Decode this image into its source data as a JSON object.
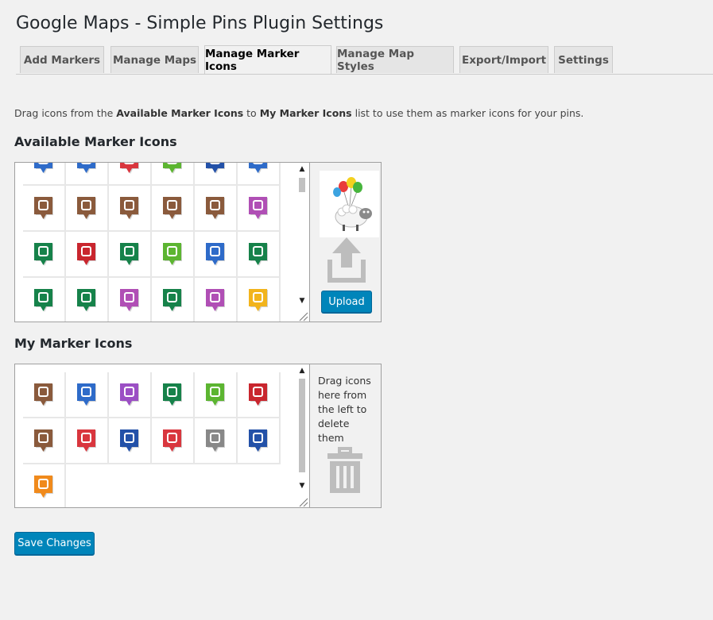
{
  "page": {
    "title": "Google Maps - Simple Pins Plugin Settings"
  },
  "tabs": [
    {
      "label": "Add Markers",
      "active": false
    },
    {
      "label": "Manage Maps",
      "active": false
    },
    {
      "label": "Manage Marker Icons",
      "active": true
    },
    {
      "label": "Manage Map Styles",
      "active": false
    },
    {
      "label": "Export/Import",
      "active": false
    },
    {
      "label": "Settings",
      "active": false
    }
  ],
  "description": {
    "prefix": "Drag icons from the ",
    "source_name": "Available Marker Icons",
    "middle": " to ",
    "target_name": "My Marker Icons",
    "suffix": " list to use them as marker icons for your pins."
  },
  "available": {
    "title": "Available Marker Icons",
    "upload_label": "Upload",
    "upload_preview_icon": "flying-sheep-with-balloons-image",
    "upload_arrow_icon": "upload-arrow-icon",
    "rows": [
      [
        {
          "icon": "marker-partial-icon",
          "color": "#2e6bc9"
        },
        {
          "icon": "marker-partial-icon",
          "color": "#2e6bc9"
        },
        {
          "icon": "marker-partial-icon",
          "color": "#d9363e"
        },
        {
          "icon": "marker-partial-icon",
          "color": "#5cb531"
        },
        {
          "icon": "marker-partial-icon",
          "color": "#2351a8"
        },
        {
          "icon": "marker-partial-icon",
          "color": "#2e6bc9"
        }
      ],
      [
        {
          "icon": "crossed-tools-icon",
          "color": "#8a5a3c"
        },
        {
          "icon": "airplane-icon",
          "color": "#8a5a3c"
        },
        {
          "icon": "aircraft-hangar-icon",
          "color": "#8a5a3c"
        },
        {
          "icon": "runway-plane-icon",
          "color": "#8a5a3c"
        },
        {
          "icon": "factory-icon",
          "color": "#8a5a3c"
        },
        {
          "icon": "waterslide-icon",
          "color": "#b04fb5"
        }
      ],
      [
        {
          "icon": "tree-icon",
          "color": "#16824a"
        },
        {
          "icon": "alien-icon",
          "color": "#c9262e"
        },
        {
          "icon": "crocodile-icon",
          "color": "#16824a"
        },
        {
          "icon": "radar-icon",
          "color": "#5cb531"
        },
        {
          "icon": "fountain-icon",
          "color": "#2e6bc9"
        },
        {
          "icon": "swimming-icon",
          "color": "#16824a"
        }
      ],
      [
        {
          "icon": "weathervane-icon",
          "color": "#16824a"
        },
        {
          "icon": "hands-heart-icon",
          "color": "#16824a"
        },
        {
          "icon": "birthday-cake-icon",
          "color": "#b04fb5"
        },
        {
          "icon": "ant-icon",
          "color": "#16824a"
        },
        {
          "icon": "person-icon",
          "color": "#b04fb5"
        },
        {
          "icon": "building-icon",
          "color": "#f2b41c"
        }
      ]
    ]
  },
  "mine": {
    "title": "My Marker Icons",
    "drop_hint": "Drag icons here from the left to delete them",
    "trash_icon": "trash-can-icon",
    "rows": [
      [
        {
          "icon": "airplane-icon",
          "color": "#8a5a3c"
        },
        {
          "icon": "money-bag-icon",
          "color": "#2e6bc9"
        },
        {
          "icon": "toilet-icon",
          "color": "#9b4fc4"
        },
        {
          "icon": "ant-icon",
          "color": "#16824a"
        },
        {
          "icon": "recycle-icon",
          "color": "#5cb531"
        },
        {
          "icon": "alien-icon",
          "color": "#c9262e"
        }
      ],
      [
        {
          "icon": "runway-plane-icon",
          "color": "#8a5a3c"
        },
        {
          "icon": "breastfeeding-icon",
          "color": "#d9363e"
        },
        {
          "icon": "fishing-icon",
          "color": "#2351a8"
        },
        {
          "icon": "footprint-icon",
          "color": "#d9363e"
        },
        {
          "icon": "folder-icon",
          "color": "#888888"
        },
        {
          "icon": "u-turn-icon",
          "color": "#2351a8"
        }
      ],
      [
        {
          "icon": "jeep-icon",
          "color": "#f08a1c"
        }
      ]
    ]
  },
  "footer": {
    "save_label": "Save Changes"
  },
  "colors": {
    "primary_button": "#0085ba",
    "page_background": "#f1f1f1"
  }
}
